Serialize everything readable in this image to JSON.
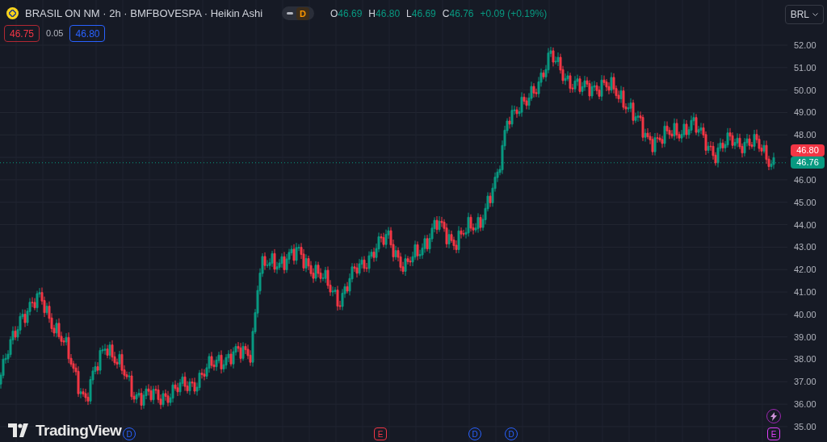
{
  "header": {
    "title": "BRASIL ON NM · 2h · BMFBOVESPA · Heikin Ashi",
    "session_badge": "D",
    "ohlc": [
      {
        "label": "O",
        "value": "46.69"
      },
      {
        "label": "H",
        "value": "46.80"
      },
      {
        "label": "L",
        "value": "46.69"
      },
      {
        "label": "C",
        "value": "46.76"
      }
    ],
    "change": "+0.09 (+0.19%)"
  },
  "trade": {
    "sell": "46.75",
    "spread": "0.05",
    "buy": "46.80"
  },
  "currency": "BRL",
  "price_axis": {
    "upper": [
      "52.00",
      "51.00",
      "50.00",
      "49.00",
      "48.00"
    ],
    "lower": [
      "46.00",
      "45.00",
      "44.00",
      "43.00",
      "42.00",
      "41.00",
      "40.00",
      "39.00",
      "38.00",
      "37.00",
      "36.00",
      "35.00"
    ]
  },
  "price_tags": [
    {
      "text": "46.80",
      "color": "#f23645"
    },
    {
      "text": "46.76",
      "color": "#089981"
    }
  ],
  "logo": "TradingView",
  "events": [
    {
      "kind": "dividend",
      "text": "D",
      "color": "#2962ff"
    },
    {
      "kind": "earnings",
      "text": "E",
      "color": "#f23645"
    },
    {
      "kind": "dividend",
      "text": "D",
      "color": "#2962ff"
    },
    {
      "kind": "dividend",
      "text": "D",
      "color": "#2962ff"
    },
    {
      "kind": "earnings",
      "text": "E",
      "color": "#e040fb"
    }
  ]
}
